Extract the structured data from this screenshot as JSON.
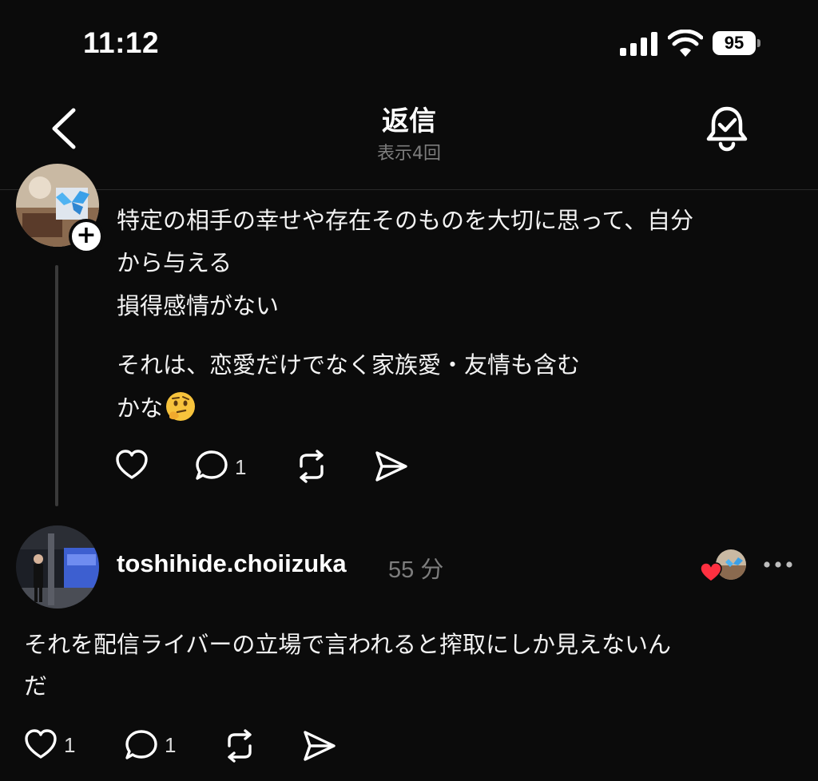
{
  "status_bar": {
    "time": "11:12",
    "battery": "95"
  },
  "header": {
    "title": "返信",
    "subtitle": "表示4回"
  },
  "thread": [
    {
      "avatar": "butterfly-photo",
      "follow_badge": "+",
      "text_lines": [
        "特定の相手の幸せや存在そのものを大切に思って、自分",
        "から与える",
        "損得感情がない",
        "それは、恋愛だけでなく家族愛・友情も含む",
        "かな"
      ],
      "emoji": "thinking-face",
      "actions": {
        "like_count": "",
        "reply_count": "1",
        "repost_count": "",
        "share_count": ""
      }
    },
    {
      "avatar": "station-photo",
      "username": "toshihide.choiizuka",
      "time": "55 分",
      "text_lines": [
        "それを配信ライバーの立場で言われると搾取にしか見えないん",
        "だ"
      ],
      "actions": {
        "like_count": "1",
        "reply_count": "1",
        "repost_count": "",
        "share_count": ""
      }
    }
  ],
  "colors": {
    "background": "#0b0b0b",
    "text": "#f3f3f3",
    "muted": "#7d7d7d",
    "heart": "#ff3040"
  }
}
